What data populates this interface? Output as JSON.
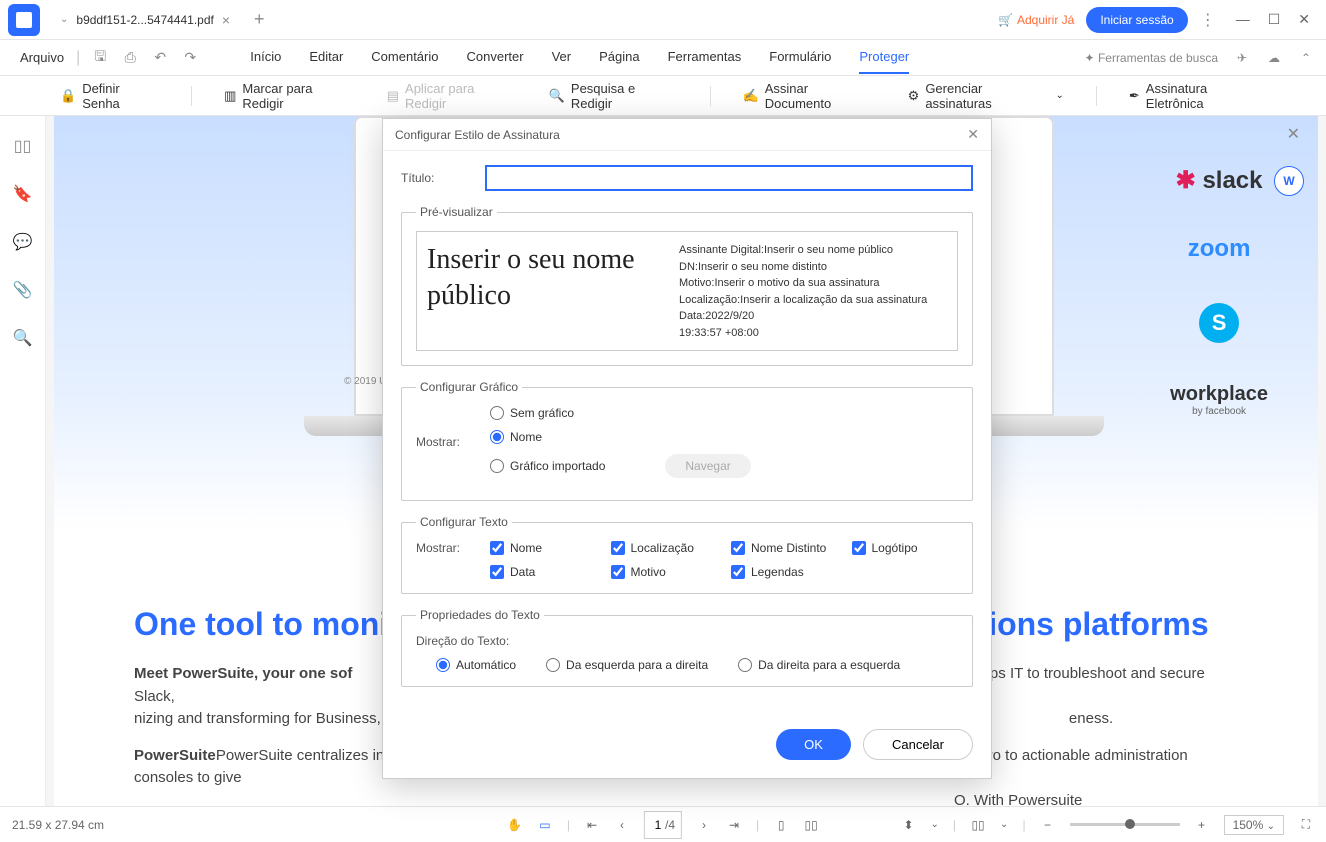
{
  "titlebar": {
    "tab_name": "b9ddf151-2...5474441.pdf",
    "acquire": "Adquirir Já",
    "login": "Iniciar sessão"
  },
  "menubar": {
    "file": "Arquivo",
    "tabs": [
      "Início",
      "Editar",
      "Comentário",
      "Converter",
      "Ver",
      "Página",
      "Ferramentas",
      "Formulário",
      "Proteger"
    ],
    "search_tools": "Ferramentas de busca"
  },
  "toolbar": {
    "set_password": "Definir Senha",
    "mark_redact": "Marcar para Redigir",
    "apply_redact": "Aplicar para Redigir",
    "search_redact": "Pesquisa e Redigir",
    "sign_doc": "Assinar Documento",
    "manage_sigs": "Gerenciar assinaturas",
    "e_sig": "Assinatura Eletrônica"
  },
  "doc": {
    "heading": "One tool to monitor",
    "heading_right": "ations platforms",
    "p1a": "Meet PowerSuite, your one sof",
    "p1b": "hts and helps IT to troubleshoot and secure Slack,",
    "p1c": "nizing and transforming for Business, and Workplace by",
    "p1d": "eness.",
    "p2a": "PowerSuite centralizes informa",
    "p2b": "om zero to actionable administration consoles to give",
    "p2c": "O. With Powersuite",
    "logos": {
      "slack": "slack",
      "zoom": "zoom",
      "workplace": "workplace",
      "workplace_by": "by facebook"
    },
    "copyright": "© 2019 Unify"
  },
  "dialog": {
    "title": "Configurar Estilo de Assinatura",
    "field_title": "Título:",
    "preview_legend": "Pré-visualizar",
    "preview_name": "Inserir o seu nome público",
    "preview_meta": {
      "l1": "Assinante Digital:Inserir o seu nome público",
      "l2": "DN:Inserir o seu nome distinto",
      "l3": "Motivo:Inserir o motivo da sua assinatura",
      "l4": "Localização:Inserir a localização da sua assinatura",
      "l5": "Data:2022/9/20",
      "l6": " 19:33:57 +08:00"
    },
    "cfg_graphic": {
      "legend": "Configurar Gráfico",
      "show": "Mostrar:",
      "none": "Sem gráfico",
      "name": "Nome",
      "imported": "Gráfico importado",
      "browse": "Navegar"
    },
    "cfg_text": {
      "legend": "Configurar Texto",
      "show": "Mostrar:",
      "name": "Nome",
      "location": "Localização",
      "dn": "Nome Distinto",
      "logo": "Logótipo",
      "date": "Data",
      "reason": "Motivo",
      "labels": "Legendas"
    },
    "text_props": {
      "legend": "Propriedades do Texto",
      "dir_label": "Direção do Texto:",
      "auto": "Automático",
      "ltr": "Da esquerda para a direita",
      "rtl": "Da direita para a esquerda"
    },
    "ok": "OK",
    "cancel": "Cancelar"
  },
  "statusbar": {
    "dims": "21.59 x 27.94 cm",
    "page": "1",
    "page_total": "/4",
    "zoom": "150%"
  }
}
